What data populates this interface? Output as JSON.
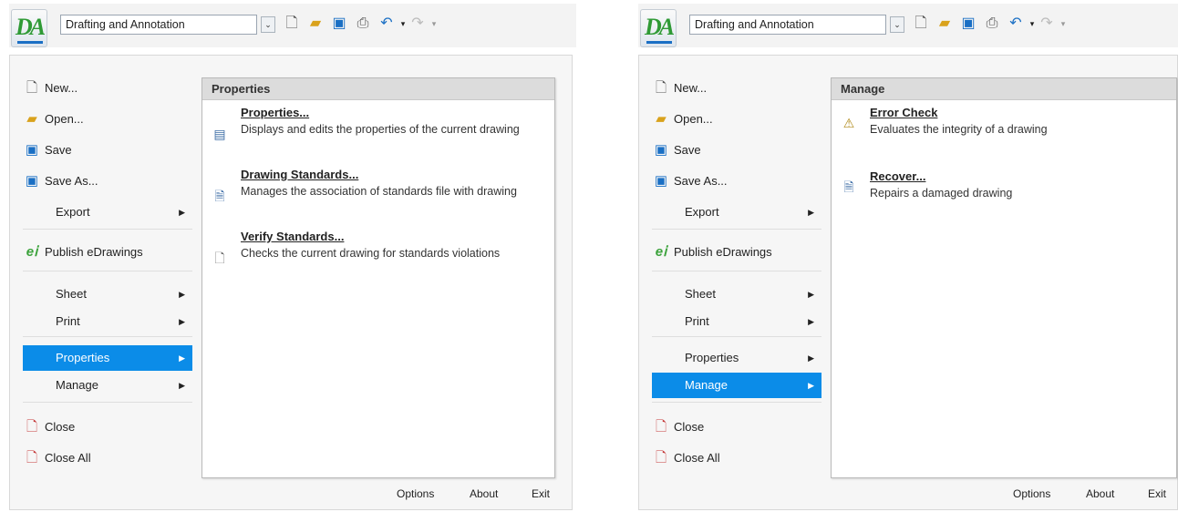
{
  "toolbar": {
    "logo_text": "DA",
    "configuration_value": "Drafting and Annotation",
    "configuration_dropdown_glyph": "⌄",
    "icons": [
      "new-document-icon",
      "open-folder-icon",
      "save-disk-icon",
      "print-icon",
      "undo-icon",
      "redo-icon",
      "customize-toolbar-icon"
    ]
  },
  "menu": {
    "items": [
      {
        "label": "New...",
        "icon": "new-document-icon"
      },
      {
        "label": "Open...",
        "icon": "open-folder-icon"
      },
      {
        "label": "Save",
        "icon": "save-disk-icon"
      },
      {
        "label": "Save As...",
        "icon": "save-as-icon"
      },
      {
        "label": "Export",
        "has_submenu": true
      },
      {
        "label": "Publish eDrawings",
        "icon": "edrawings-icon"
      },
      {
        "label": "Sheet",
        "has_submenu": true
      },
      {
        "label": "Print",
        "has_submenu": true
      },
      {
        "label": "Properties",
        "has_submenu": true
      },
      {
        "label": "Manage",
        "has_submenu": true
      },
      {
        "label": "Close",
        "icon": "close-document-icon"
      },
      {
        "label": "Close All",
        "icon": "close-all-icon"
      }
    ],
    "arrow": "▶"
  },
  "footer": {
    "options": "Options",
    "about": "About",
    "exit": "Exit"
  },
  "left_panel": {
    "selected_item": "Properties",
    "submenu": {
      "title": "Properties",
      "items": [
        {
          "title": "Properties...",
          "description": "Displays and edits the properties of the current drawing",
          "icon": "properties-sheet-icon"
        },
        {
          "title": "Drawing Standards...",
          "description": "Manages the association of standards file with drawing",
          "icon": "drawing-standards-icon"
        },
        {
          "title": "Verify Standards...",
          "description": "Checks the current drawing for standards violations",
          "icon": "verify-standards-icon"
        }
      ]
    }
  },
  "right_panel": {
    "selected_item": "Manage",
    "submenu": {
      "title": "Manage",
      "items": [
        {
          "title": "Error Check",
          "description": "Evaluates the integrity of a drawing",
          "icon": "error-check-icon"
        },
        {
          "title": "Recover...",
          "description": "Repairs a damaged drawing",
          "icon": "recover-drawing-icon"
        }
      ]
    }
  },
  "colors": {
    "selection": "#0b8ce8",
    "menu_background": "#f6f6f6",
    "submenu_header": "#dcdcdc"
  }
}
